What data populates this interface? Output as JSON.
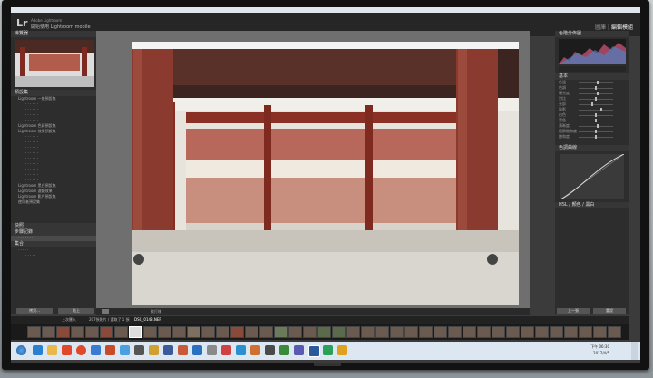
{
  "lightroom": {
    "logo": "Lr",
    "subtitle": "Adobe Lightroom",
    "account_line": "開始使用 Lightroom mobile",
    "modules": {
      "library": "圖庫",
      "separator": "|",
      "develop": "編輯模組"
    }
  },
  "left_panel": {
    "navigator_header": "導覽器",
    "presets_header": "預設集",
    "preset_items": [
      "Lightroom 一般預設集",
      "Lightroom 色彩預設集",
      "Lightroom 效果預設集",
      "Lightroom 黑白預設集",
      "Lightroom 濾鏡效果",
      "Lightroom 影片預設集",
      "使用者預設集"
    ],
    "snapshots_header": "快照",
    "history_header": "步驟記錄",
    "collections_header": "集合",
    "copy_button": "拷貝...",
    "paste_button": "貼上"
  },
  "toolbar": {
    "softproof_label": "軟打樣"
  },
  "right_panel": {
    "histogram_header": "色階分佈圖",
    "basic_header": "基本",
    "tone_curve_header": "色調曲線",
    "hsl_header": "HSL / 顏色 / 黑白",
    "previous_button": "上一張",
    "reset_button": "重設",
    "slider_labels": [
      "色溫",
      "色調",
      "曝光度",
      "對比",
      "亮部",
      "陰影",
      "白色",
      "黑色",
      "清晰度",
      "細節飽和度",
      "飽和度"
    ]
  },
  "filmstrip": {
    "source_label": "上次匯入",
    "count_label": "207張照片 / 選取了 1 張",
    "filename": "DSC_0148.NEF"
  },
  "taskbar": {
    "time": "下午 06:30",
    "date": "2017/4/5"
  },
  "colors": {
    "lr_dark": "#262626",
    "panel": "#2d2d2d",
    "taskbar": "#dde7f1",
    "temple_red": "#8a2c22"
  }
}
